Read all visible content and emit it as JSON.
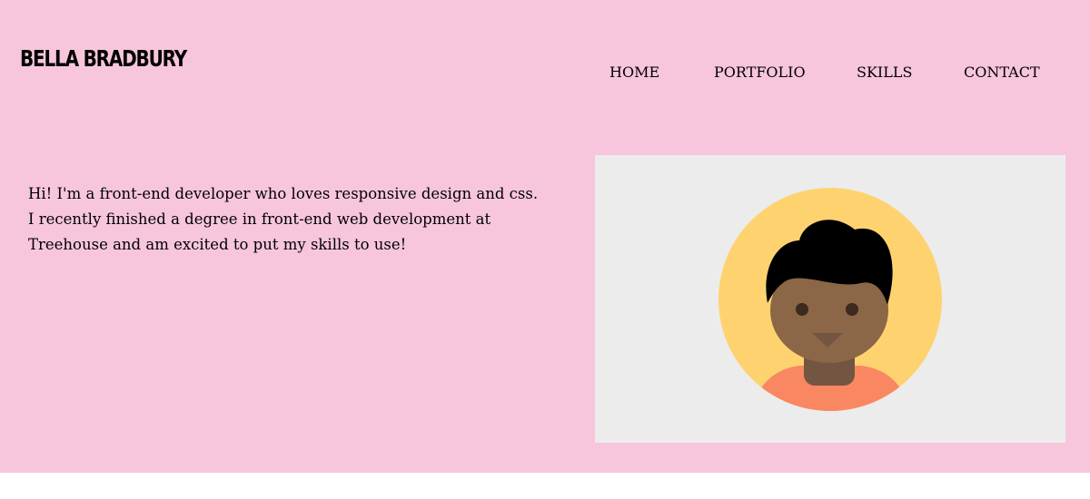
{
  "header": {
    "logo": "BELLA BRADBURY",
    "nav": [
      "HOME",
      "PORTFOLIO",
      "SKILLS",
      "CONTACT"
    ]
  },
  "hero": {
    "intro": "Hi! I'm a front-end developer who loves responsive design and css. I recently finished a degree in front-end web development at Treehouse and am excited to put my skills to use!",
    "avatar_icon": "person-avatar-illustration"
  },
  "colors": {
    "background": "#f7c6dc",
    "avatar_frame": "#ececec",
    "avatar_circle": "#fed36f",
    "skin": "#8b6647",
    "hair": "#000000",
    "shirt": "#f98762"
  }
}
